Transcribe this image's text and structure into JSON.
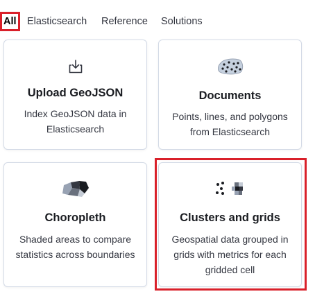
{
  "tabs": [
    {
      "label": "All",
      "active": true
    },
    {
      "label": "Elasticsearch",
      "active": false
    },
    {
      "label": "Reference",
      "active": false
    },
    {
      "label": "Solutions",
      "active": false
    }
  ],
  "cards": {
    "upload_geojson": {
      "title": "Upload GeoJSON",
      "description": "Index GeoJSON data in Elasticsearch",
      "icon": "upload-icon"
    },
    "documents": {
      "title": "Documents",
      "description": "Points, lines, and polygons from Elasticsearch",
      "icon": "documents-points-icon"
    },
    "choropleth": {
      "title": "Choropleth",
      "description": "Shaded areas to compare statistics across boundaries",
      "icon": "choropleth-icon"
    },
    "clusters_grids": {
      "title": "Clusters and grids",
      "description": "Geospatial data grouped in grids with metrics for each gridded cell",
      "icon": "clusters-grids-icon"
    }
  },
  "colors": {
    "highlight": "#d9202a",
    "card_border": "#d3dae6",
    "text": "#343741",
    "title": "#1a1c21"
  }
}
